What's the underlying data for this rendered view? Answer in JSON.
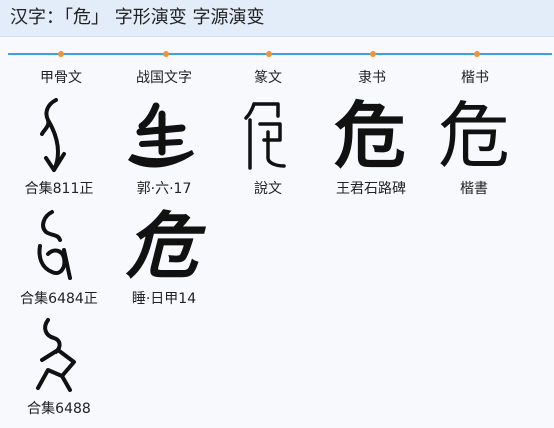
{
  "header": {
    "title": "汉字：「危」 字形演变 字源演变"
  },
  "stages": [
    {
      "label": "甲骨文"
    },
    {
      "label": "战国文字"
    },
    {
      "label": "篆文"
    },
    {
      "label": "隶书"
    },
    {
      "label": "楷书"
    }
  ],
  "glyphs": {
    "jiagu_1": {
      "caption": "合集811正",
      "icon": "oracle-bone-glyph"
    },
    "jiagu_2": {
      "caption": "合集6484正",
      "icon": "oracle-bone-glyph"
    },
    "jiagu_3": {
      "caption": "合集6488",
      "icon": "oracle-bone-glyph"
    },
    "zhanguo_1": {
      "caption": "郭·六·17",
      "icon": "bamboo-slip-glyph"
    },
    "zhanguo_2": {
      "caption": "睡·日甲14",
      "char": "危"
    },
    "zhuan_1": {
      "caption": "說文",
      "icon": "seal-script-glyph"
    },
    "li_1": {
      "caption": "王君石路碑",
      "char": "危"
    },
    "kai_1": {
      "caption": "楷書",
      "char": "危"
    }
  },
  "colors": {
    "header_bg": "#e3edf9",
    "timeline": "#3ea1e6",
    "timeline_dot": "#f0923b",
    "ink": "#111111"
  }
}
